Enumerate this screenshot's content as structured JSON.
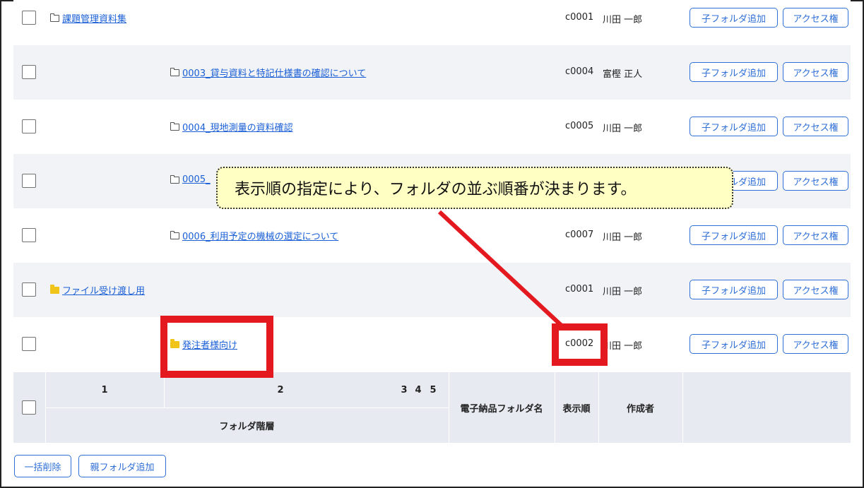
{
  "rows": [
    {
      "folder": "課題管理資料集",
      "code": "c0001",
      "author": "川田 一郎",
      "add_label": "子フォルダ追加",
      "access_label": "アクセス権"
    },
    {
      "folder": "0003_貸与資料と特記仕様書の確認について",
      "code": "c0004",
      "author": "富樫 正人",
      "add_label": "子フォルダ追加",
      "access_label": "アクセス権"
    },
    {
      "folder": "0004_現地測量の資料確認",
      "code": "c0005",
      "author": "川田 一郎",
      "add_label": "子フォルダ追加",
      "access_label": "アクセス権"
    },
    {
      "folder": "0005_",
      "code": "",
      "author": "",
      "add_label": "子フォルダ追加",
      "access_label": "アクセス権"
    },
    {
      "folder": "0006_利用予定の機械の選定について",
      "code": "c0007",
      "author": "川田 一郎",
      "add_label": "子フォルダ追加",
      "access_label": "アクセス権"
    },
    {
      "folder": "ファイル受け渡し用",
      "code": "c0001",
      "author": "川田 一郎",
      "add_label": "子フォルダ追加",
      "access_label": "アクセス権"
    },
    {
      "folder": "発注者様向け",
      "code": "c0002",
      "author": "川田 一郎",
      "add_label": "子フォルダ追加",
      "access_label": "アクセス権"
    }
  ],
  "header": {
    "levels": [
      "1",
      "2",
      "3",
      "4",
      "5"
    ],
    "hierarchy": "フォルダ階層",
    "folder_name": "電子納品フォルダ名",
    "order": "表示順",
    "author": "作成者"
  },
  "footer": {
    "bulk_delete": "一括削除",
    "add_parent": "親フォルダ追加"
  },
  "callout": {
    "text": "表示順の指定により、フォルダの並ぶ順番が決まります。"
  },
  "icons": {
    "outline_folder": "folder-outline-icon",
    "filled_folder": "folder-filled-icon"
  },
  "colors": {
    "link": "#1a5fd6",
    "button": "#2f6fd6",
    "highlight": "#e4191f",
    "callout_bg": "#ffffc4",
    "folder_fill": "#f0c419"
  }
}
